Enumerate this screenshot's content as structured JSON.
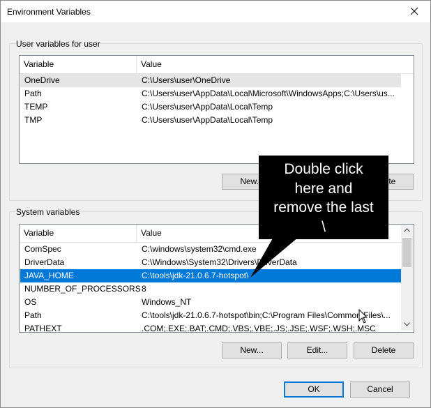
{
  "window": {
    "title": "Environment Variables"
  },
  "user_vars": {
    "group_label": "User variables for user",
    "header": {
      "variable": "Variable",
      "value": "Value"
    },
    "rows": [
      {
        "variable": "OneDrive",
        "value": "C:\\Users\\user\\OneDrive"
      },
      {
        "variable": "Path",
        "value": "C:\\Users\\user\\AppData\\Local\\Microsoft\\WindowsApps;C:\\Users\\us..."
      },
      {
        "variable": "TEMP",
        "value": "C:\\Users\\user\\AppData\\Local\\Temp"
      },
      {
        "variable": "TMP",
        "value": "C:\\Users\\user\\AppData\\Local\\Temp"
      }
    ],
    "buttons": {
      "new": "New...",
      "delete": "Delete"
    }
  },
  "system_vars": {
    "group_label": "System variables",
    "header": {
      "variable": "Variable",
      "value": "Value"
    },
    "rows": [
      {
        "variable": "ComSpec",
        "value": "C:\\windows\\system32\\cmd.exe"
      },
      {
        "variable": "DriverData",
        "value": "C:\\Windows\\System32\\Drivers\\DriverData"
      },
      {
        "variable": "JAVA_HOME",
        "value": "C:\\tools\\jdk-21.0.6.7-hotspot\\"
      },
      {
        "variable": "NUMBER_OF_PROCESSORS",
        "value": "8"
      },
      {
        "variable": "OS",
        "value": "Windows_NT"
      },
      {
        "variable": "Path",
        "value": "C:\\tools\\jdk-21.0.6.7-hotspot\\bin;C:\\Program Files\\Common Files\\..."
      },
      {
        "variable": "PATHEXT",
        "value": ".COM;.EXE;.BAT;.CMD;.VBS;.VBE;.JS;.JSE;.WSF;.WSH;.MSC"
      }
    ],
    "selected_variable": "JAVA_HOME",
    "buttons": {
      "new": "New...",
      "edit": "Edit...",
      "delete": "Delete"
    }
  },
  "dialog_buttons": {
    "ok": "OK",
    "cancel": "Cancel"
  },
  "callout": {
    "lines": [
      "Double click",
      "here and",
      "remove the last",
      "\\"
    ]
  },
  "colors": {
    "selection": "#0078d7",
    "default_button_border": "#0078d7",
    "callout_background": "#000000"
  },
  "icons": {
    "close": "close-icon",
    "scroll_up": "chevron-up-icon",
    "scroll_down": "chevron-down-icon",
    "cursor": "mouse-pointer-icon"
  }
}
